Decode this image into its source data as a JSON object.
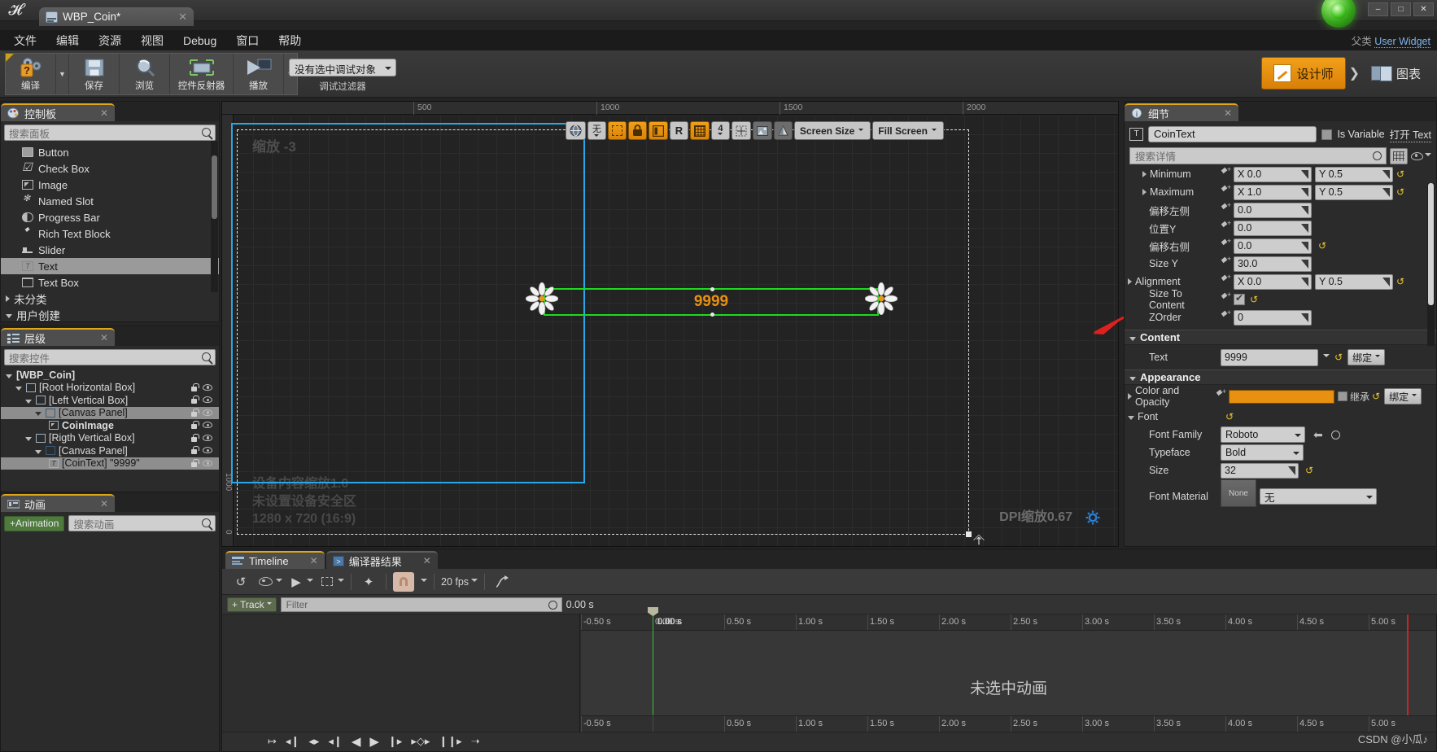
{
  "window": {
    "title": "WBP_Coin*",
    "tab_icon": "widget-blueprint-icon",
    "minimize": "–",
    "maximize": "□",
    "close": "✕"
  },
  "menubar": {
    "items": [
      "文件",
      "编辑",
      "资源",
      "视图",
      "Debug",
      "窗口",
      "帮助"
    ]
  },
  "class_label": {
    "prefix": "父类",
    "value": "User Widget"
  },
  "toolbar": {
    "buttons": [
      {
        "label": "编译",
        "icon": "compile-question-icon",
        "has_dropdown": true
      },
      {
        "label": "保存",
        "icon": "save-floppy-icon",
        "has_dropdown": false
      },
      {
        "label": "浏览",
        "icon": "browse-magnifier-icon",
        "has_dropdown": false
      },
      {
        "label": "控件反射器",
        "icon": "widget-reflector-icon",
        "has_dropdown": false
      },
      {
        "label": "播放",
        "icon": "play-triangle-icon",
        "has_dropdown": true
      }
    ],
    "debug_object": "没有选中调试对象",
    "debug_filter_caption": "调试过滤器",
    "mode_designer": "设计师",
    "mode_graph": "图表"
  },
  "palette": {
    "tab_title": "控制板",
    "tab_icon": "palette-icon",
    "search_placeholder": "搜索面板",
    "items": [
      {
        "label": "Button",
        "icon": "button-icon",
        "selected": false
      },
      {
        "label": "Check Box",
        "icon": "checkbox-icon",
        "selected": false
      },
      {
        "label": "Image",
        "icon": "image-icon",
        "selected": false
      },
      {
        "label": "Named Slot",
        "icon": "named-slot-icon",
        "selected": false
      },
      {
        "label": "Progress Bar",
        "icon": "progress-bar-icon",
        "selected": false
      },
      {
        "label": "Rich Text Block",
        "icon": "rich-text-icon",
        "selected": false
      },
      {
        "label": "Slider",
        "icon": "slider-icon",
        "selected": false
      },
      {
        "label": "Text",
        "icon": "text-icon",
        "selected": true
      },
      {
        "label": "Text Box",
        "icon": "text-box-icon",
        "selected": false
      }
    ],
    "categories": [
      {
        "label": "未分类",
        "expanded": false
      },
      {
        "label": "用户创建",
        "expanded": true
      }
    ]
  },
  "hierarchy": {
    "tab_title": "层级",
    "tab_icon": "hierarchy-icon",
    "search_placeholder": "搜索控件",
    "nodes": [
      {
        "label": "[WBP_Coin]",
        "depth": 0,
        "icon": "",
        "selected": false,
        "bold": true,
        "locks": false
      },
      {
        "label": "[Root Horizontal Box]",
        "depth": 1,
        "icon": "horizontal-box-icon",
        "selected": false,
        "locks": true
      },
      {
        "label": "[Left Vertical Box]",
        "depth": 2,
        "icon": "vertical-box-icon",
        "selected": false,
        "locks": true
      },
      {
        "label": "[Canvas Panel]",
        "depth": 3,
        "icon": "canvas-panel-icon",
        "selected": true,
        "locks": true
      },
      {
        "label": "CoinImage",
        "depth": 4,
        "icon": "image-icon",
        "selected": false,
        "bold": true,
        "locks": true
      },
      {
        "label": "[Rigth Vertical Box]",
        "depth": 2,
        "icon": "vertical-box-icon",
        "selected": false,
        "locks": true
      },
      {
        "label": "[Canvas Panel]",
        "depth": 3,
        "icon": "canvas-panel-icon",
        "selected": false,
        "locks": true
      },
      {
        "label": "[CoinText] \"9999\"",
        "depth": 4,
        "icon": "text-icon",
        "selected": true,
        "locks": true
      }
    ]
  },
  "animations": {
    "tab_title": "动画",
    "tab_icon": "animation-icon",
    "add_label": "+Animation",
    "search_placeholder": "搜索动画"
  },
  "viewport": {
    "zoom_label": "缩放 -3",
    "ruler_labels": [
      "500",
      "1000",
      "1500",
      "2000"
    ],
    "ruler_v_labels": [
      "1000",
      "0"
    ],
    "device_scale": "设备内容缩放1.0",
    "safe_zone": "未设置设备安全区",
    "resolution": "1280 x 720 (16:9)",
    "dpi_scale": "DPI缩放0.67",
    "toolbar": [
      {
        "icon": "globe-icon",
        "state": "off"
      },
      {
        "icon": "none-label",
        "label": "无",
        "state": "off"
      },
      {
        "icon": "dashed-square-icon",
        "state": "on"
      },
      {
        "icon": "lock-icon",
        "state": "on"
      },
      {
        "icon": "layout-icon",
        "state": "on"
      },
      {
        "icon": "r-label",
        "label": "R",
        "state": "off"
      },
      {
        "icon": "grid-icon",
        "state": "on"
      },
      {
        "icon": "number-4-label",
        "label": "4",
        "state": "off"
      },
      {
        "icon": "ruler-icon",
        "state": "off"
      },
      {
        "icon": "picture-icon",
        "state": "dark"
      },
      {
        "icon": "contrast-icon",
        "state": "dark"
      }
    ],
    "screen_size": "Screen Size",
    "fill_mode": "Fill Screen",
    "selected_text_value": "9999"
  },
  "details": {
    "tab_title": "细节",
    "tab_icon": "details-info-icon",
    "widget_name": "CoinText",
    "is_variable_label": "Is Variable",
    "is_variable_checked": false,
    "open_text_label": "打开 Text",
    "search_placeholder": "搜索详情",
    "slot_rows": [
      {
        "label": "Minimum",
        "expandable": true,
        "x": "X  0.0",
        "y": "Y  0.5",
        "revert": true
      },
      {
        "label": "Maximum",
        "expandable": true,
        "x": "X  1.0",
        "y": "Y  0.5",
        "revert": true
      },
      {
        "label": "偏移左侧",
        "expandable": false,
        "x": "0.0",
        "y": null,
        "revert": false
      },
      {
        "label": "位置Y",
        "expandable": false,
        "x": "0.0",
        "y": null,
        "revert": false
      },
      {
        "label": "偏移右侧",
        "expandable": false,
        "x": "0.0",
        "y": null,
        "revert": true
      },
      {
        "label": "Size Y",
        "expandable": false,
        "x": "30.0",
        "y": null,
        "revert": false
      },
      {
        "label": "Alignment",
        "expandable": true,
        "x": "X  0.0",
        "y": "Y  0.5",
        "revert": true
      },
      {
        "label": "Size To Content",
        "expandable": false,
        "checkbox": true,
        "checked": true,
        "revert": true
      },
      {
        "label": "ZOrder",
        "expandable": false,
        "x": "0",
        "y": null,
        "revert": false
      }
    ],
    "content_section": "Content",
    "text_label": "Text",
    "text_value": "9999",
    "bind_label": "绑定",
    "appearance_section": "Appearance",
    "color_label": "Color and Opacity",
    "color_value": "#e8900f",
    "inherit_label": "继承",
    "font_label": "Font",
    "font_family_label": "Font Family",
    "font_family_value": "Roboto",
    "typeface_label": "Typeface",
    "typeface_value": "Bold",
    "size_label": "Size",
    "size_value": "32",
    "font_material_label": "Font Material",
    "font_material_value": "无",
    "font_material_thumb": "None"
  },
  "bottom": {
    "tabs": [
      {
        "label": "Timeline",
        "icon": "timeline-icon",
        "active": true
      },
      {
        "label": "编译器结果",
        "icon": "compiler-results-icon",
        "active": false
      }
    ],
    "fps": "20 fps",
    "track_button": "Track",
    "filter_placeholder": "Filter",
    "time_value": "0.00 s",
    "playhead_time": "0.00 s",
    "no_animation": "未选中动画",
    "time_ticks": [
      "-0.50 s",
      "0.00 s",
      "0.50 s",
      "1.00 s",
      "1.50 s",
      "2.00 s",
      "2.50 s",
      "3.00 s",
      "3.50 s",
      "4.00 s",
      "4.50 s",
      "5.00 s"
    ],
    "watermark": "CSDN @小瓜♪"
  }
}
